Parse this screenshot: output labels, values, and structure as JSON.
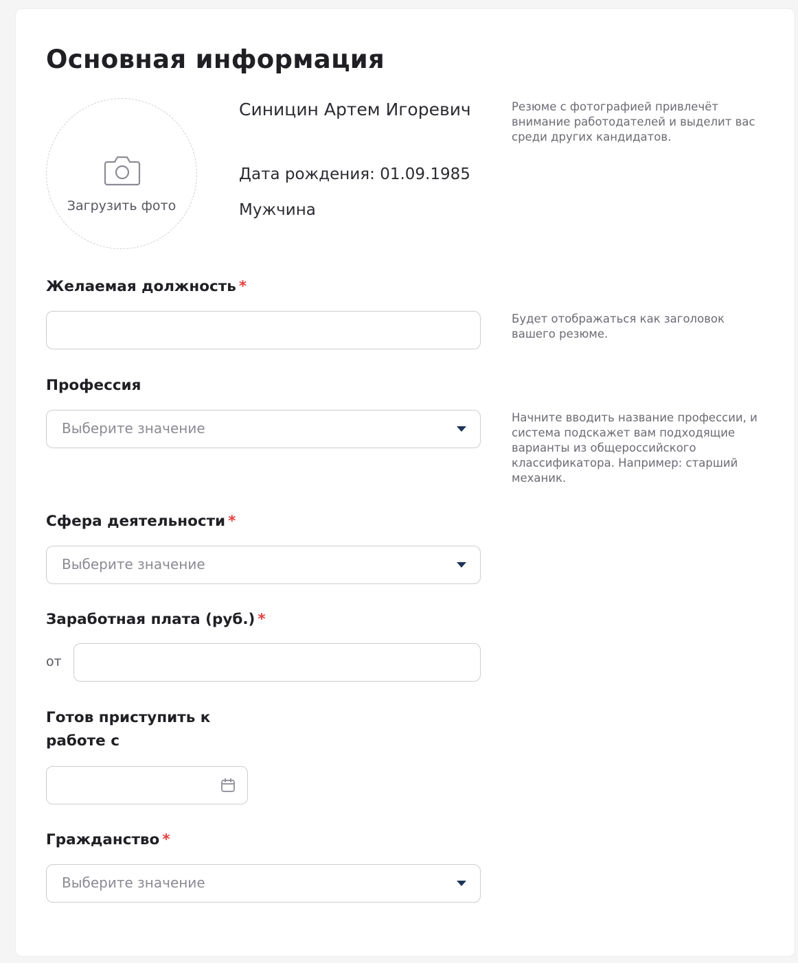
{
  "section": {
    "title": "Основная информация"
  },
  "photo": {
    "upload_label": "Загрузить фото",
    "icon": "camera-icon",
    "hint": "Резюме с фотографией привлечёт внимание работодателей и выделит вас среди других кандидатов."
  },
  "person": {
    "name": "Синицин Артем Игоревич",
    "birth_date": "Дата рождения: 01.09.1985",
    "gender": "Мужчина"
  },
  "fields": {
    "position": {
      "label": "Желаемая должность",
      "required_mark": "*",
      "value": "",
      "hint": "Будет отображаться как заголовок вашего резюме."
    },
    "profession": {
      "label": "Профессия",
      "placeholder": "Выберите значение",
      "hint": "Начните вводить название профессии, и система подскажет вам подходящие варианты из общероссийского классификатора. Например: старший механик."
    },
    "sphere": {
      "label": "Сфера деятельности",
      "required_mark": "*",
      "placeholder": "Выберите значение"
    },
    "salary": {
      "label": "Заработная плата (руб.)",
      "required_mark": "*",
      "from_label": "от",
      "value": ""
    },
    "start_date": {
      "label": "Готов приступить к работе с",
      "value": "",
      "icon": "calendar-icon"
    },
    "citizenship": {
      "label": "Гражданство",
      "required_mark": "*",
      "placeholder": "Выберите значение"
    }
  },
  "colors": {
    "required": "#e3413f",
    "caret": "#1d3458",
    "border": "#cdcdd3"
  }
}
